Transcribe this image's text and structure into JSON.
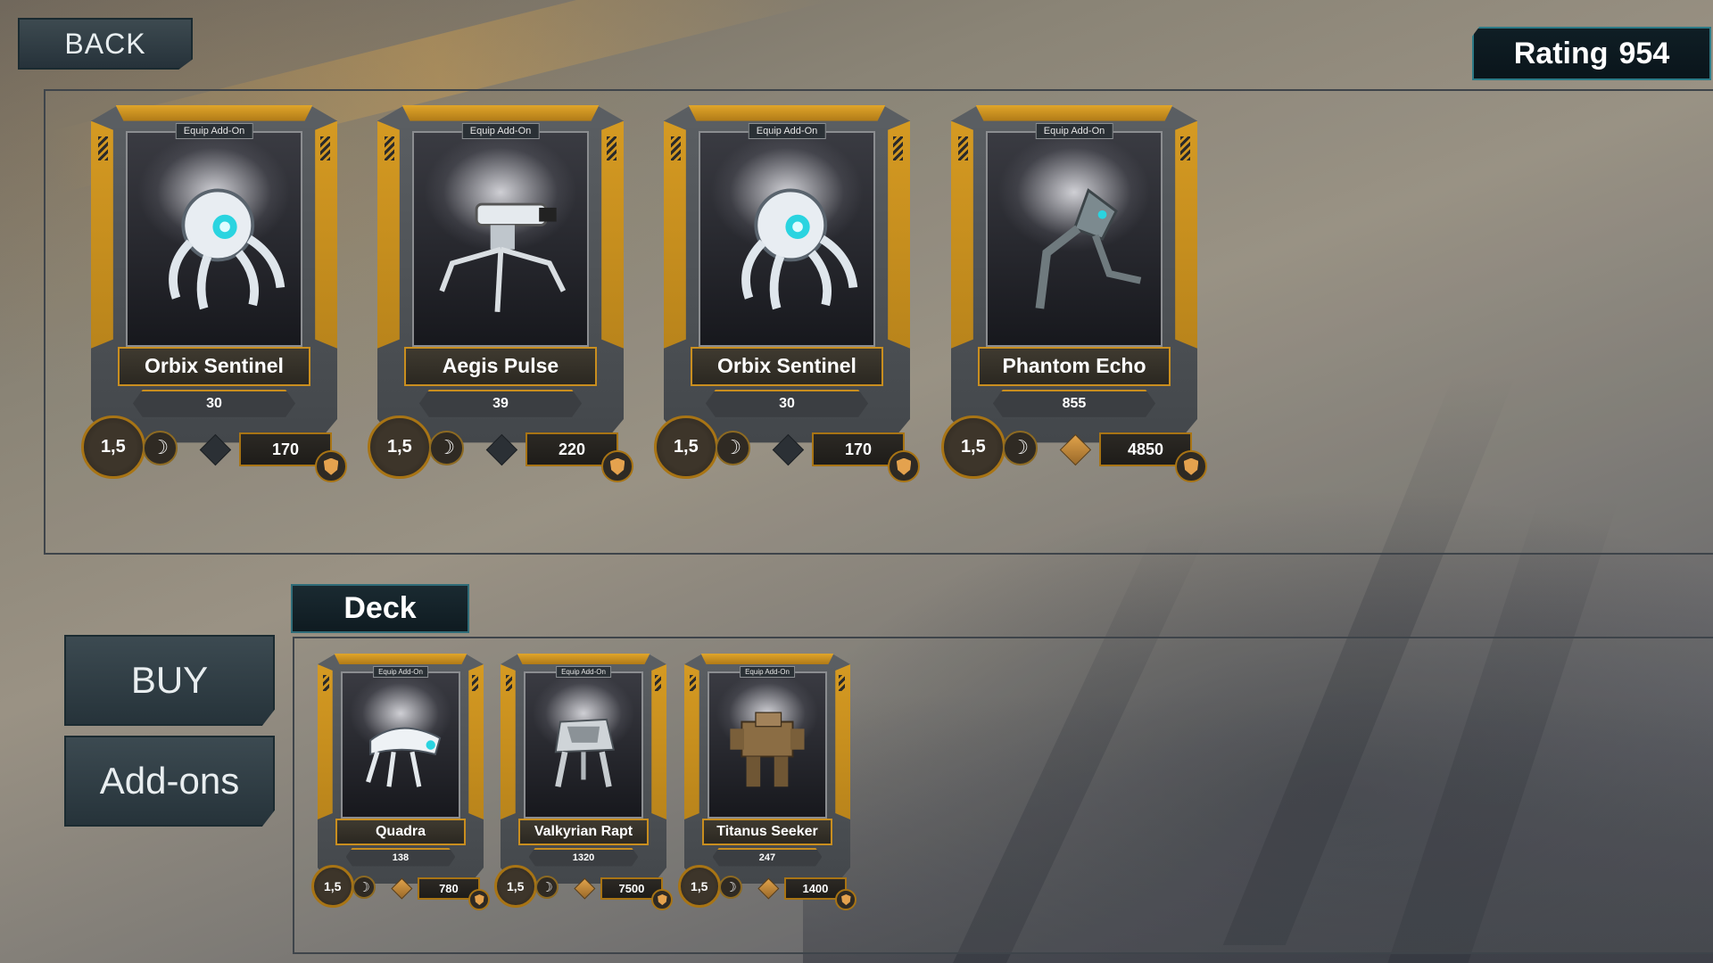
{
  "header": {
    "back_label": "BACK",
    "rating_label": "Rating",
    "rating_value": "954"
  },
  "sidebar": {
    "buy_label": "BUY",
    "addons_label": "Add-ons"
  },
  "deck_tab_label": "Deck",
  "collection": [
    {
      "tag": "Equip Add-On",
      "name": "Orbix Sentinel",
      "power": "30",
      "speed": "1,5",
      "cost": "170",
      "diamond": "dark",
      "icon": "sphere-drone"
    },
    {
      "tag": "Equip Add-On",
      "name": "Aegis Pulse",
      "power": "39",
      "speed": "1,5",
      "cost": "220",
      "diamond": "dark",
      "icon": "turret-drone"
    },
    {
      "tag": "Equip Add-On",
      "name": "Orbix Sentinel",
      "power": "30",
      "speed": "1,5",
      "cost": "170",
      "diamond": "dark",
      "icon": "sphere-drone"
    },
    {
      "tag": "Equip Add-On",
      "name": "Phantom Echo",
      "power": "855",
      "speed": "1,5",
      "cost": "4850",
      "diamond": "gold",
      "icon": "walker-mech"
    }
  ],
  "deck": [
    {
      "tag": "Equip Add-On",
      "name": "Quadra",
      "power": "138",
      "speed": "1,5",
      "cost": "780",
      "diamond": "gold",
      "icon": "crawler-drone"
    },
    {
      "tag": "Equip Add-On",
      "name": "Valkyrian Rapt",
      "power": "1320",
      "speed": "1,5",
      "cost": "7500",
      "diamond": "gold",
      "icon": "raptor-mech"
    },
    {
      "tag": "Equip Add-On",
      "name": "Titanus Seeker",
      "power": "247",
      "speed": "1,5",
      "cost": "1400",
      "diamond": "gold",
      "icon": "heavy-mech"
    }
  ],
  "colors": {
    "gold": "#d59a22",
    "teal_border": "#2c7a86",
    "panel_dark": "#0f1e25"
  }
}
